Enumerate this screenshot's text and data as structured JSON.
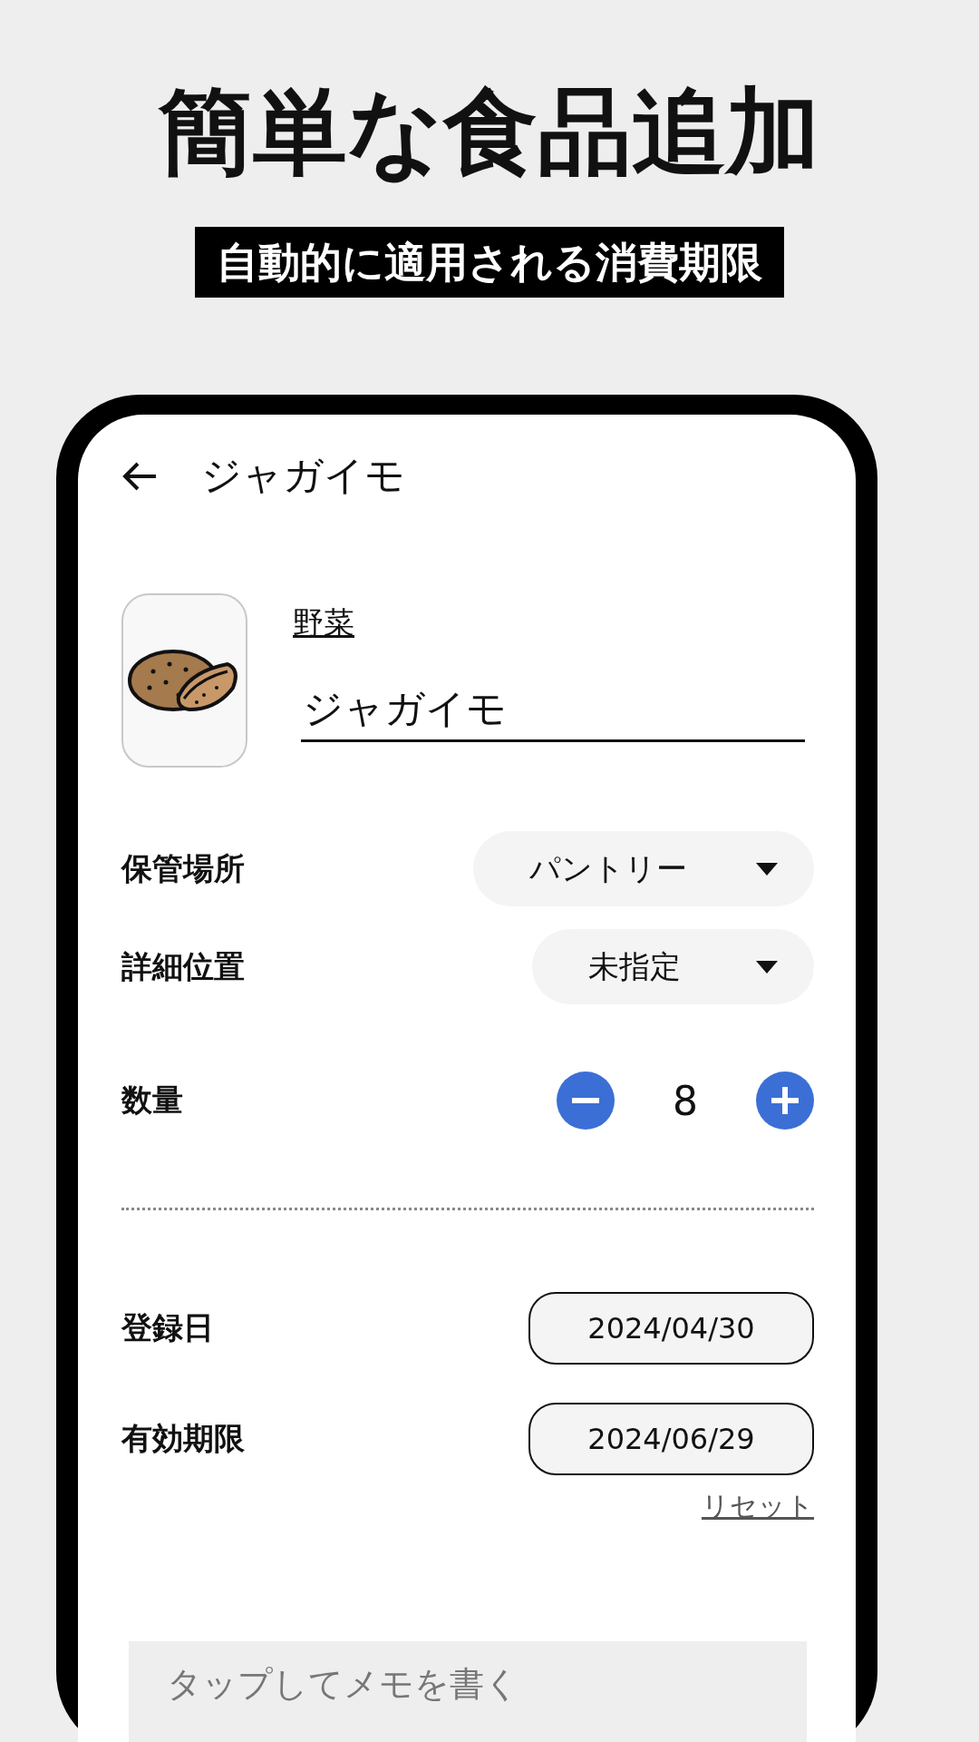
{
  "headline": "簡単な食品追加",
  "subheadline": "自動的に適用される消費期限",
  "screen": {
    "title": "ジャガイモ",
    "item": {
      "category": "野菜",
      "name": "ジャガイモ"
    },
    "selects": [
      {
        "label": "保管場所",
        "value": "パントリー"
      },
      {
        "label": "詳細位置",
        "value": "未指定"
      }
    ],
    "quantity": {
      "label": "数量",
      "value": "8"
    },
    "dates": [
      {
        "label": "登録日",
        "value": "2024/04/30"
      },
      {
        "label": "有効期限",
        "value": "2024/06/29"
      }
    ],
    "reset_link": "リセット",
    "memo": {
      "placeholder": "タップしてメモを書く"
    }
  }
}
